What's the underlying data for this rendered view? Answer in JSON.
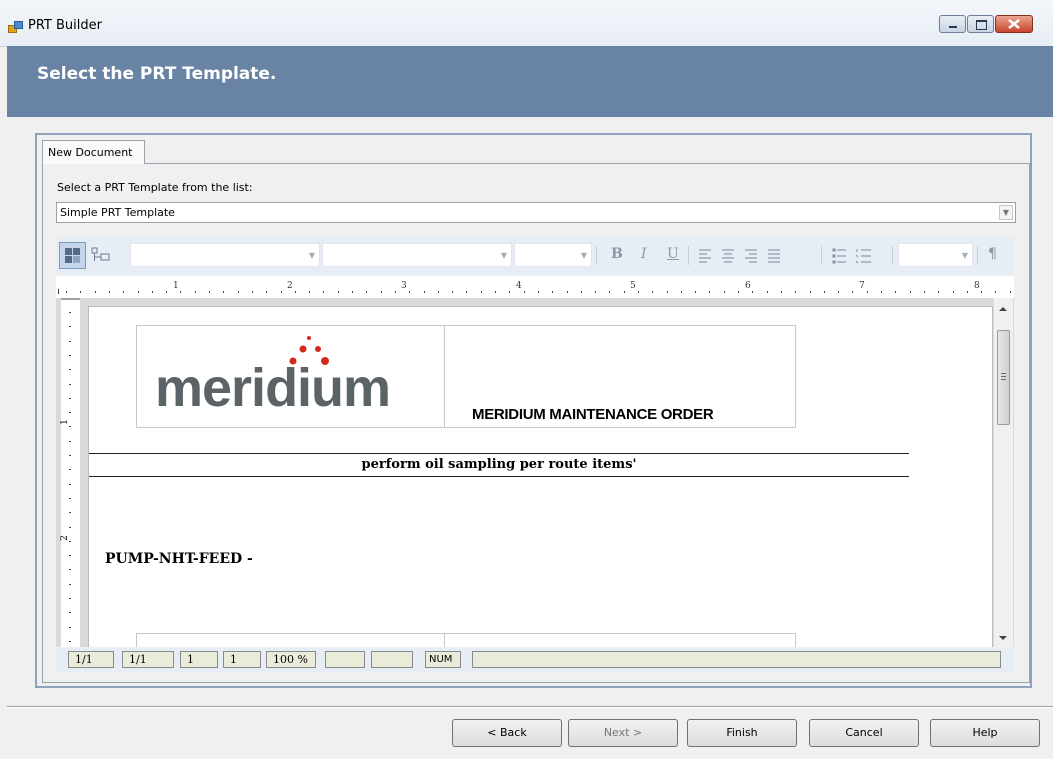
{
  "window": {
    "title": "PRT Builder"
  },
  "header": {
    "title": "Select the PRT Template."
  },
  "tabs": [
    {
      "label": "New Document"
    }
  ],
  "template_select": {
    "label": "Select a PRT Template from the list:",
    "value": "Simple PRT Template"
  },
  "toolbar": {
    "icons": [
      "layout-icon",
      "insert-field-icon",
      "bold-icon",
      "italic-icon",
      "underline-icon",
      "align-left-icon",
      "align-center-icon",
      "align-right-icon",
      "justify-icon",
      "bullets-icon",
      "numbering-icon",
      "pilcrow-icon"
    ],
    "bold": "B",
    "italic": "I",
    "underline": "U",
    "pilcrow": "¶"
  },
  "ruler": {
    "numbers": [
      "1",
      "2",
      "3",
      "4",
      "5",
      "6",
      "7",
      "8"
    ],
    "vertical_numbers": [
      "1",
      "2"
    ]
  },
  "document": {
    "logo_text": "meridium",
    "order_title": "MERIDIUM MAINTENANCE ORDER",
    "description": "perform oil sampling per route items'",
    "equipment": "PUMP-NHT-FEED -"
  },
  "status": {
    "page": "1/1",
    "section": "1/1",
    "line": "1",
    "column": "1",
    "zoom": "100 %",
    "num": "NUM"
  },
  "buttons": {
    "back": "< Back",
    "next": "Next >",
    "finish": "Finish",
    "cancel": "Cancel",
    "help": "Help"
  },
  "colors": {
    "header_band": "#6883a3",
    "logo_gray": "#5b6367",
    "logo_dots": "#d42a1e"
  }
}
